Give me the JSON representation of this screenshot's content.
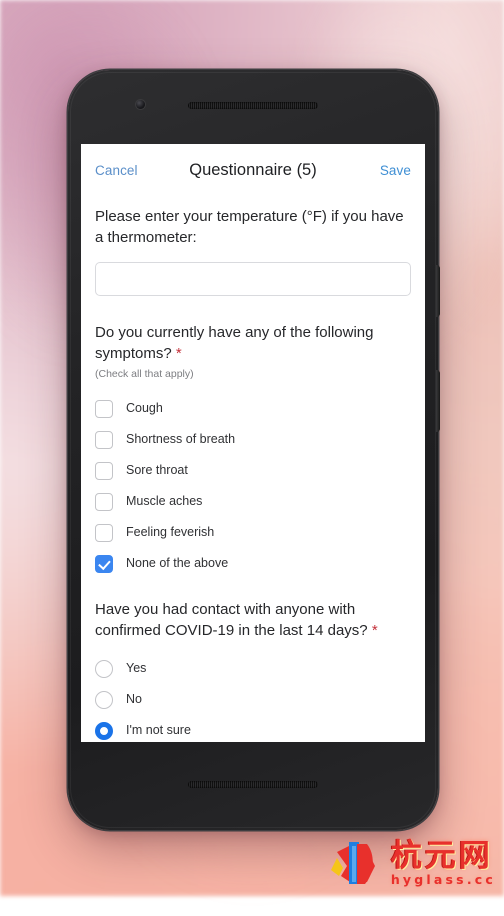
{
  "navbar": {
    "cancel_label": "Cancel",
    "title": "Questionnaire (5)",
    "save_label": "Save"
  },
  "form": {
    "temperature": {
      "question": "Please enter your temperature (°F) if you have a thermometer:",
      "value": "",
      "placeholder": ""
    },
    "symptoms": {
      "question": "Do you currently have any of the following symptoms?",
      "required_mark": "*",
      "hint": "(Check all that apply)",
      "options": [
        {
          "label": "Cough",
          "checked": false
        },
        {
          "label": "Shortness of breath",
          "checked": false
        },
        {
          "label": "Sore throat",
          "checked": false
        },
        {
          "label": "Muscle aches",
          "checked": false
        },
        {
          "label": "Feeling feverish",
          "checked": false
        },
        {
          "label": "None of the above",
          "checked": true
        }
      ]
    },
    "contact": {
      "question": "Have you had contact with anyone with confirmed COVID-19 in the last 14 days?",
      "required_mark": "*",
      "options": [
        {
          "label": "Yes",
          "selected": false
        },
        {
          "label": "No",
          "selected": false
        },
        {
          "label": "I'm not sure",
          "selected": true
        }
      ]
    }
  },
  "watermark": {
    "chinese": "杭元网",
    "english": "hyglass.cc"
  },
  "colors": {
    "accent_blue": "#3b86f0",
    "radio_blue": "#1a73e8",
    "link_blue": "#5b8fc9",
    "required_red": "#c4303a",
    "watermark_red": "#e8302c"
  }
}
